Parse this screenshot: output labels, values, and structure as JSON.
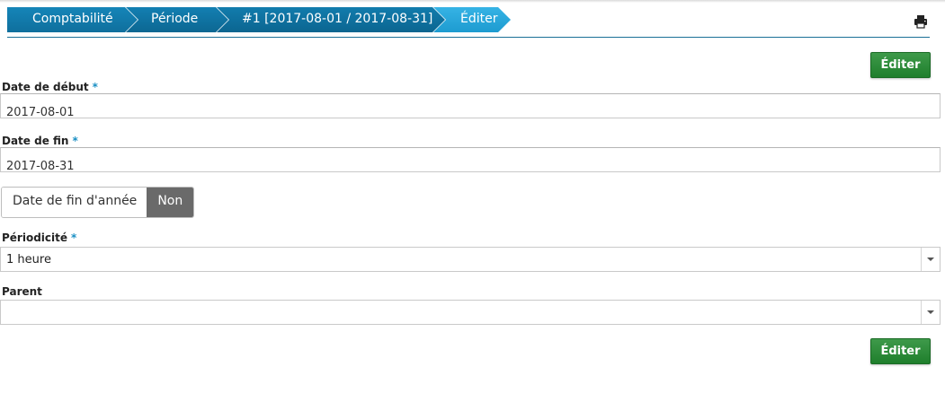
{
  "breadcrumb": {
    "items": [
      {
        "label": "Comptabilité"
      },
      {
        "label": "Période"
      },
      {
        "label": "#1 [2017-08-01 / 2017-08-31]"
      },
      {
        "label": "Éditer"
      }
    ]
  },
  "toolbar": {
    "print_icon": "print-icon",
    "edit_label": "Éditer"
  },
  "form": {
    "start_date": {
      "label": "Date de début",
      "required": "*",
      "value": "2017-08-01"
    },
    "end_date": {
      "label": "Date de fin",
      "required": "*",
      "value": "2017-08-31"
    },
    "year_end": {
      "label": "Date de fin d'année",
      "state": "Non"
    },
    "periodicity": {
      "label": "Périodicité",
      "required": "*",
      "value": "1 heure"
    },
    "parent": {
      "label": "Parent",
      "value": ""
    }
  },
  "footer": {
    "edit_label": "Éditer"
  },
  "colors": {
    "breadcrumb_dark": "#0f6f9d",
    "breadcrumb_active": "#1d9bd0",
    "button_green": "#2a8a36",
    "required_star": "#1a8fc4",
    "toggle_off": "#6a6a6a"
  }
}
